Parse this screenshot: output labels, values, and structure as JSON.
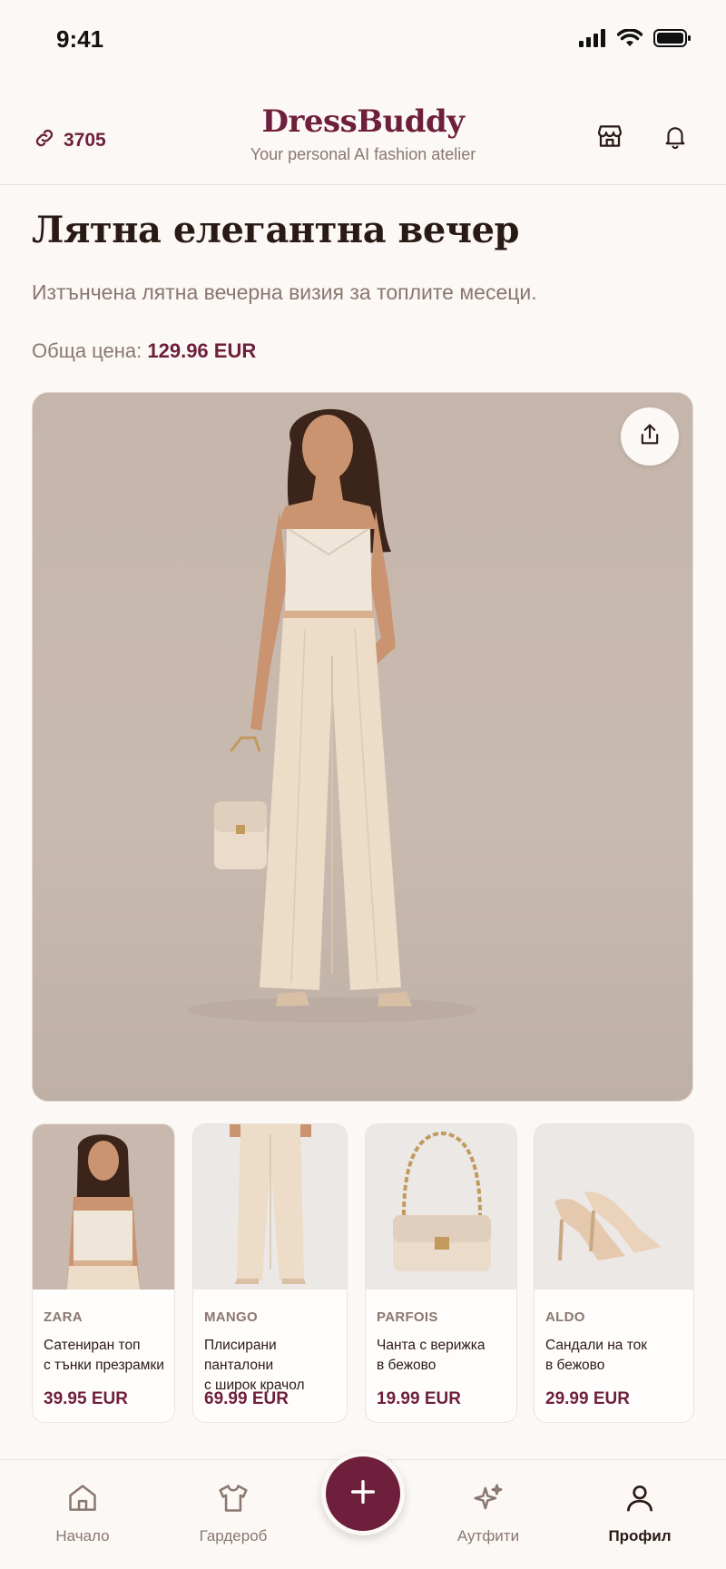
{
  "status": {
    "time": "9:41"
  },
  "header": {
    "points": "3705",
    "brand": "DressBuddy",
    "tagline": "Your personal AI fashion atelier"
  },
  "outfit": {
    "title": "Лятна елегантна вечер",
    "subtitle": "Изтънчена лятна вечерна визия за топлите месеци.",
    "price_label": "Обща цена:",
    "price_value": "129.96 EUR"
  },
  "products": [
    {
      "brand": "ZARA",
      "name_line1": "Сатениран топ",
      "name_line2": "с тънки презрамки",
      "price": "39.95 EUR"
    },
    {
      "brand": "MANGO",
      "name_line1": "Плисирани панталони",
      "name_line2": "с широк крачол",
      "price": "69.99 EUR"
    },
    {
      "brand": "PARFOIS",
      "name_line1": "Чанта с верижка",
      "name_line2": "в бежово",
      "price": "19.99 EUR"
    },
    {
      "brand": "ALDO",
      "name_line1": "Сандали на ток",
      "name_line2": "в бежово",
      "price": "29.99 EUR"
    }
  ],
  "tabs": {
    "home": "Начало",
    "wardrobe": "Гардероб",
    "outfits": "Аутфити",
    "profile": "Профил"
  },
  "colors": {
    "accent": "#6e1f3c",
    "background": "#fbf8f5",
    "muted": "#8a7770"
  }
}
